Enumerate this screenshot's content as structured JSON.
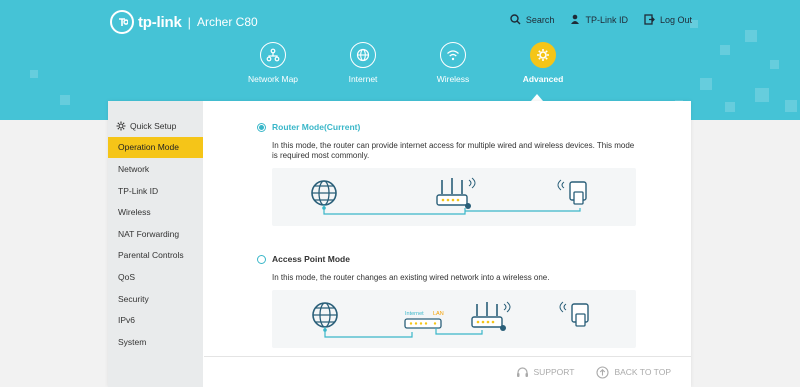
{
  "header": {
    "brand": "tp-link",
    "model": "Archer C80",
    "links": [
      {
        "label": "Search",
        "icon": "search-icon"
      },
      {
        "label": "TP-Link ID",
        "icon": "user-icon"
      },
      {
        "label": "Log Out",
        "icon": "logout-icon"
      }
    ]
  },
  "nav": [
    {
      "label": "Network Map",
      "icon": "network-map-icon",
      "active": false
    },
    {
      "label": "Internet",
      "icon": "globe-icon",
      "active": false
    },
    {
      "label": "Wireless",
      "icon": "wifi-icon",
      "active": false
    },
    {
      "label": "Advanced",
      "icon": "gear-icon",
      "active": true
    }
  ],
  "sidebar": {
    "items": [
      {
        "label": "Quick Setup",
        "icon": "gear-icon"
      },
      {
        "label": "Operation Mode",
        "active": true
      },
      {
        "label": "Network"
      },
      {
        "label": "TP-Link ID"
      },
      {
        "label": "Wireless"
      },
      {
        "label": "NAT Forwarding"
      },
      {
        "label": "Parental Controls"
      },
      {
        "label": "QoS"
      },
      {
        "label": "Security"
      },
      {
        "label": "IPv6"
      },
      {
        "label": "System"
      }
    ]
  },
  "modes": [
    {
      "title": "Router Mode(Current)",
      "selected": true,
      "description": "In this mode, the router can provide internet access for multiple wired and wireless devices. This mode is required most commonly."
    },
    {
      "title": "Access Point Mode",
      "selected": false,
      "description": "In this mode, the router changes an existing wired network into a wireless one.",
      "diagram_labels": {
        "internet": "Internet",
        "lan": "LAN"
      }
    }
  ],
  "footer": {
    "support": "SUPPORT",
    "back_to_top": "BACK TO TOP"
  },
  "colors": {
    "header_bg": "#45c3d6",
    "accent": "#f5c518",
    "selected": "#3ab7c9"
  }
}
